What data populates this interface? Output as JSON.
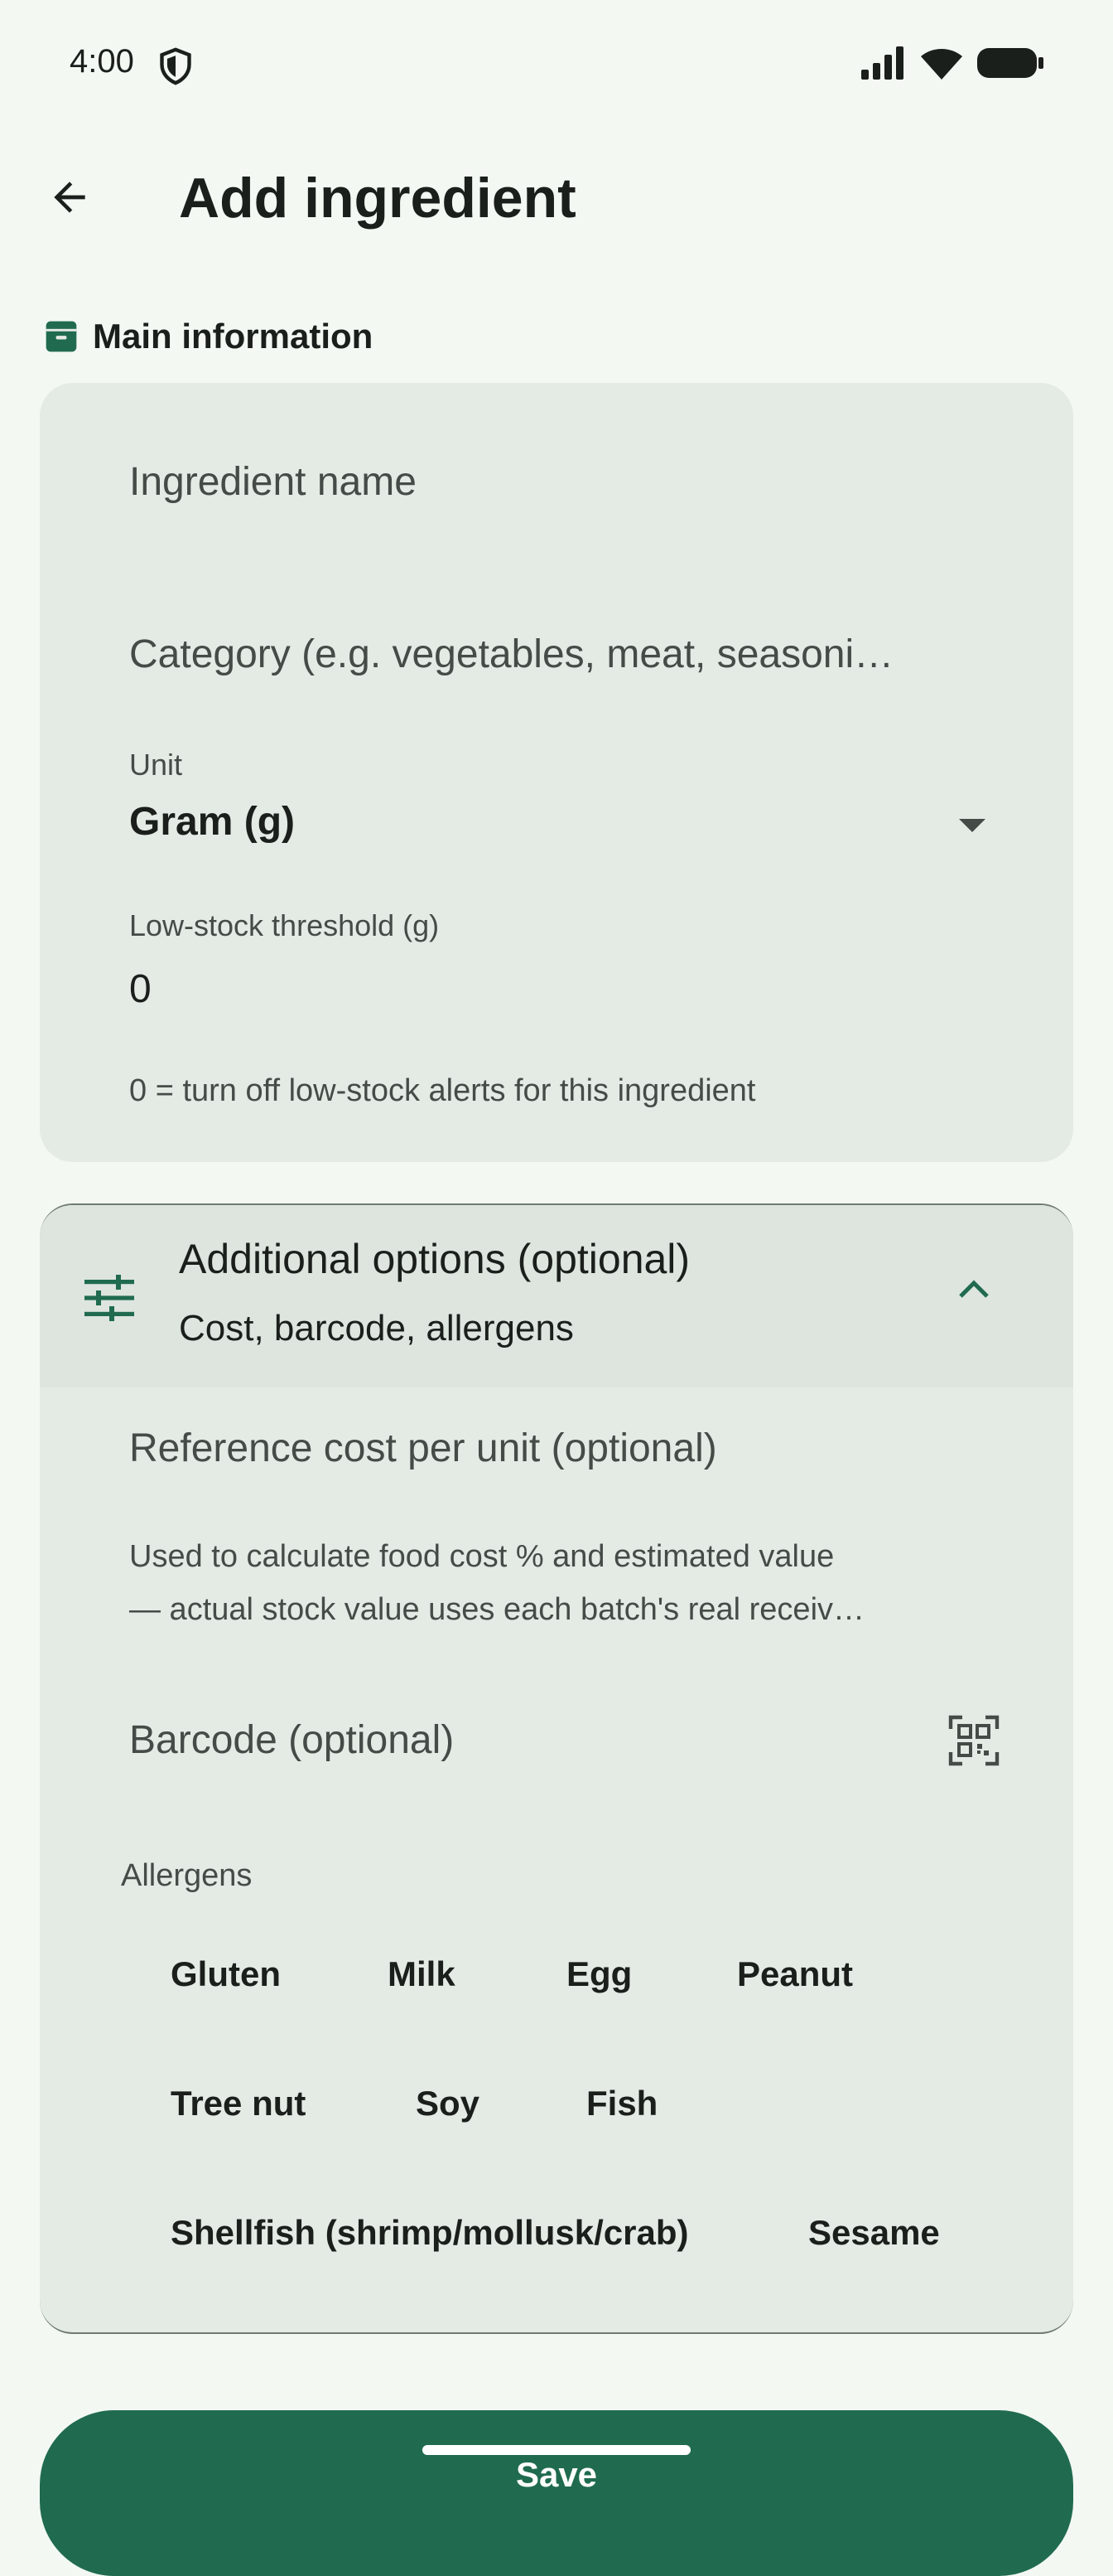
{
  "status_bar": {
    "time": "4:00"
  },
  "app_bar": {
    "title": "Add ingredient"
  },
  "main_section": {
    "label": "Main information",
    "ingredient_name_placeholder": "Ingredient name",
    "category_placeholder": "Category (e.g. vegetables, meat, seasoni…",
    "unit_label": "Unit",
    "unit_value": "Gram (g)",
    "threshold_label": "Low-stock threshold (g)",
    "threshold_value": "0",
    "threshold_helper": "0 = turn off low-stock alerts for this ingredient"
  },
  "additional": {
    "title": "Additional options (optional)",
    "subtitle": "Cost, barcode, allergens",
    "cost_placeholder": "Reference cost per unit (optional)",
    "cost_helper_line1": "Used to calculate food cost % and estimated value",
    "cost_helper_line2": "— actual stock value uses each batch's real receiv…",
    "barcode_placeholder": "Barcode (optional)",
    "allergens_label": "Allergens",
    "allergens": [
      "Gluten",
      "Milk",
      "Egg",
      "Peanut",
      "Tree nut",
      "Soy",
      "Fish",
      "Shellfish (shrimp/mollusk/crab)",
      "Sesame"
    ]
  },
  "save_label": "Save",
  "colors": {
    "accent": "#206b4f",
    "background": "#f3f8f3",
    "card": "#e4eae4"
  }
}
